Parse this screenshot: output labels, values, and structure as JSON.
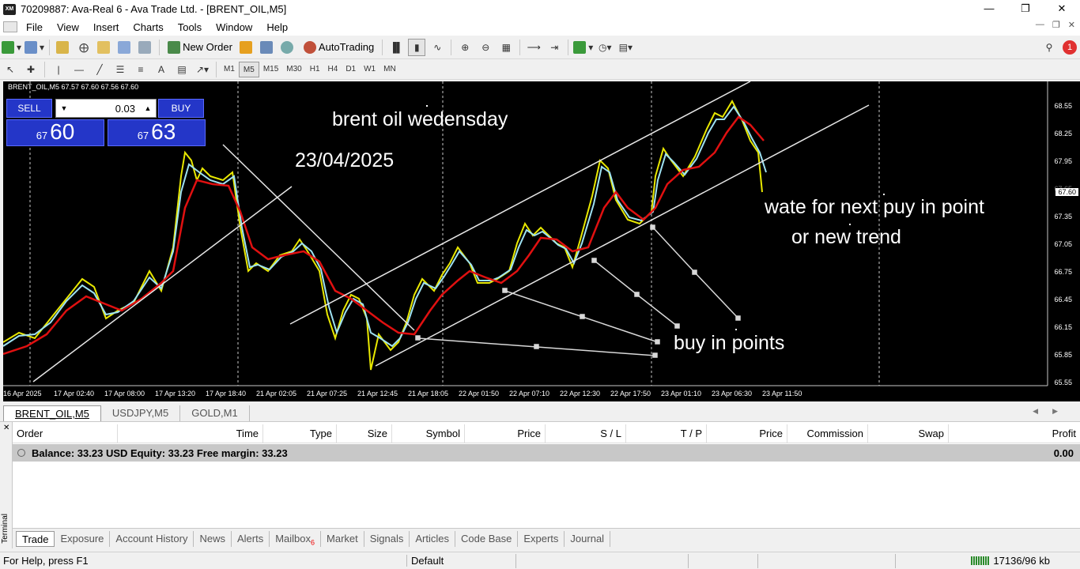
{
  "window": {
    "title": "70209887: Ava-Real 6 - Ava Trade Ltd. - [BRENT_OIL,M5]",
    "app_icon": "XM"
  },
  "menu": [
    "File",
    "View",
    "Insert",
    "Charts",
    "Tools",
    "Window",
    "Help"
  ],
  "toolbar": {
    "new_order": "New Order",
    "auto_trading": "AutoTrading"
  },
  "timeframes": [
    "M1",
    "M5",
    "M15",
    "M30",
    "H1",
    "H4",
    "D1",
    "W1",
    "MN"
  ],
  "active_timeframe": "M5",
  "chart": {
    "header": "BRENT_OIL,M5  67.57 67.60 67.56 67.60",
    "sell_label": "SELL",
    "buy_label": "BUY",
    "lot": "0.03",
    "sell_price_small": "67",
    "sell_price_big": "60",
    "buy_price_small": "67",
    "buy_price_big": "63",
    "current_price": "67.60",
    "price_axis": [
      "68.55",
      "68.25",
      "67.95",
      "67.65",
      "67.35",
      "67.05",
      "66.75",
      "66.45",
      "66.15",
      "65.85",
      "65.55"
    ],
    "time_axis": [
      "16 Apr 2025",
      "17 Apr 02:40",
      "17 Apr 08:00",
      "17 Apr 13:20",
      "17 Apr 18:40",
      "21 Apr 02:05",
      "21 Apr 07:25",
      "21 Apr 12:45",
      "21 Apr 18:05",
      "22 Apr 01:50",
      "22 Apr 07:10",
      "22 Apr 12:30",
      "22 Apr 17:50",
      "23 Apr 01:10",
      "23 Apr 06:30",
      "23 Apr 11:50"
    ],
    "annotations": {
      "title": "brent oil wedensday",
      "date": "23/04/2025",
      "note1": "wate for next puy in point",
      "note2": "or new trend",
      "buy": "buy in points"
    }
  },
  "chart_tabs": [
    "BRENT_OIL,M5",
    "USDJPY,M5",
    "GOLD,M1"
  ],
  "terminal": {
    "side_label": "Terminal",
    "columns": [
      "Order",
      "Time",
      "Type",
      "Size",
      "Symbol",
      "Price",
      "S / L",
      "T / P",
      "Price",
      "Commission",
      "Swap",
      "Profit"
    ],
    "balance_text": "Balance: 33.23 USD  Equity: 33.23  Free margin: 33.23",
    "profit": "0.00",
    "tabs": [
      "Trade",
      "Exposure",
      "Account History",
      "News",
      "Alerts",
      "Mailbox",
      "Market",
      "Signals",
      "Articles",
      "Code Base",
      "Experts",
      "Journal"
    ],
    "mailbox_count": "6"
  },
  "status": {
    "help": "For Help, press F1",
    "profile": "Default",
    "traffic": "17136/96 kb"
  }
}
